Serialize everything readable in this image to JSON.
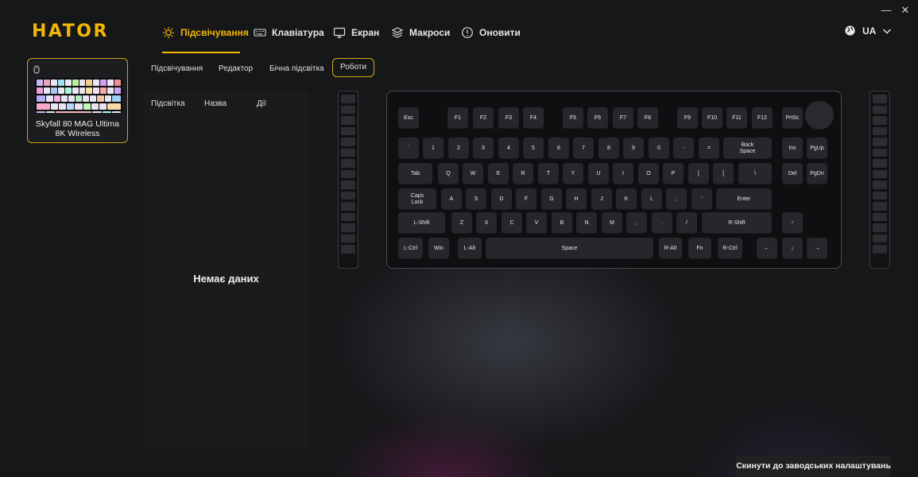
{
  "brand": "HATOR",
  "nav": [
    {
      "label": "Підсвічування",
      "icon": "sun-icon"
    },
    {
      "label": "Клавіатура",
      "icon": "keyboard-icon"
    },
    {
      "label": "Екран",
      "icon": "monitor-icon"
    },
    {
      "label": "Макроси",
      "icon": "layers-icon"
    },
    {
      "label": "Оновити",
      "icon": "info-icon"
    }
  ],
  "language": {
    "value": "UA",
    "icon": "globe-icon"
  },
  "window": {
    "minimize": "—",
    "close": "✕"
  },
  "device": {
    "name_line1": "Skyfall 80 MAG Ultima",
    "name_line2": "8K Wireless",
    "icon": "mouse-icon"
  },
  "subtabs": [
    "Підсвічування",
    "Редактор",
    "Бічна підсвітка",
    "Роботи"
  ],
  "table": {
    "headers": [
      "Підсвітка",
      "Назва",
      "Дії"
    ],
    "empty_text": "Немає даних"
  },
  "keyboard": {
    "row0": [
      "Esc",
      "F1",
      "F2",
      "F3",
      "F4",
      "F5",
      "F6",
      "F7",
      "F8",
      "F9",
      "F10",
      "F11",
      "F12",
      "PrtSc"
    ],
    "row1": [
      "`",
      "1",
      "2",
      "3",
      "4",
      "5",
      "6",
      "7",
      "8",
      "9",
      "0",
      "-",
      "=",
      "Back Space",
      "Ins",
      "PgUp"
    ],
    "row2": [
      "Tab",
      "Q",
      "W",
      "E",
      "R",
      "T",
      "Y",
      "U",
      "I",
      "O",
      "P",
      "[",
      "]",
      "\\",
      "Del",
      "PgDn"
    ],
    "row3": [
      "Caps Lock",
      "A",
      "S",
      "D",
      "F",
      "G",
      "H",
      "J",
      "K",
      "L",
      ";",
      "'",
      "Enter"
    ],
    "row4": [
      "L-Shift",
      "Z",
      "X",
      "C",
      "V",
      "B",
      "N",
      "M",
      ",",
      ".",
      "/",
      "R-Shift",
      "↑"
    ],
    "row5": [
      "L-Ctrl",
      "Win",
      "L-Alt",
      "Space",
      "R-Alt",
      "Fn",
      "R-Ctrl",
      "←",
      "↓",
      "→"
    ]
  },
  "reset_button": "Скинути до заводських налаштувань",
  "colors": {
    "accent": "#f2b705",
    "background": "#161719",
    "panel": "#1a1b1d",
    "key": "#26272a"
  }
}
